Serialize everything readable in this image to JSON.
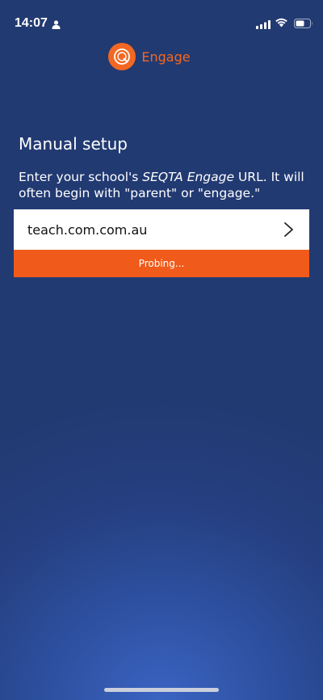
{
  "status_bar": {
    "time": "14:07",
    "icons": [
      "person-icon",
      "signal-icon",
      "wifi-icon",
      "battery-icon"
    ]
  },
  "brand": {
    "name": "Engage",
    "logo_icon": "seqta-q-logo-icon",
    "accent_color": "#f26822"
  },
  "page": {
    "title": "Manual setup",
    "instructions_before": "Enter your school's ",
    "instructions_em": "SEQTA Engage",
    "instructions_after": " URL. It will often begin with \"parent\" or \"engage.\""
  },
  "url_field": {
    "value": "teach.com.com.au",
    "submit_icon": "chevron-right-icon"
  },
  "probe_status": {
    "text": "Probing...",
    "color": "#f05a1a"
  },
  "colors": {
    "background": "#223a72",
    "background_glow": "#3a64c2"
  }
}
